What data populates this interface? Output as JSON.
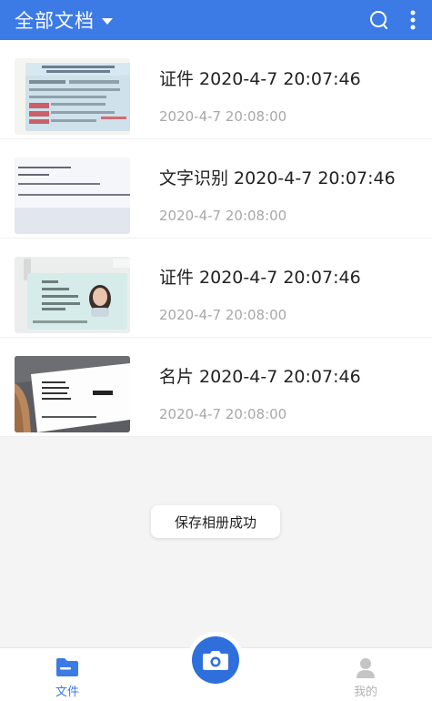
{
  "header": {
    "title": "全部文档",
    "accent": "#3c7be6"
  },
  "documents": [
    {
      "title": "证件 2020-4-7 20:07:46",
      "date": "2020-4-7 20:08:00",
      "thumbnail": "driver-license-photo"
    },
    {
      "title": "文字识别 2020-4-7 20:07:46",
      "date": "2020-4-7 20:08:00",
      "thumbnail": "text-page-photo"
    },
    {
      "title": "证件 2020-4-7 20:07:46",
      "date": "2020-4-7 20:08:00",
      "thumbnail": "id-card-photo"
    },
    {
      "title": "名片 2020-4-7 20:07:46",
      "date": "2020-4-7 20:08:00",
      "thumbnail": "business-card-photo"
    }
  ],
  "toast": {
    "message": "保存相册成功"
  },
  "bottom_nav": {
    "files_label": "文件",
    "mine_label": "我的",
    "active": "files",
    "camera_icon": "camera-icon"
  }
}
